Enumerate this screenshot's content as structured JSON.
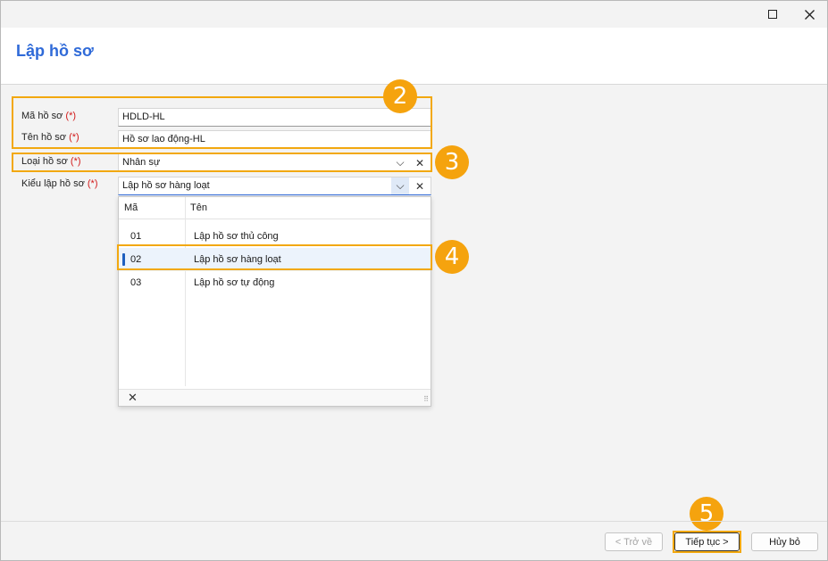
{
  "window": {
    "page_title": "Lập hồ sơ",
    "maximize_icon": "maximize-icon",
    "close_icon": "close-icon"
  },
  "form": {
    "fields": [
      {
        "label": "Mã hồ sơ",
        "required_mark": "(*)",
        "value": "HDLD-HL"
      },
      {
        "label": "Tên hồ sơ",
        "required_mark": "(*)",
        "value": "Hồ sơ lao động-HL"
      },
      {
        "label": "Loại hồ sơ",
        "required_mark": "(*)",
        "value": "Nhân sự"
      },
      {
        "label": "Kiểu lập hồ sơ",
        "required_mark": "(*)",
        "value": "Lập hồ sơ hàng loạt"
      }
    ],
    "dropdown_glyph": "⌵",
    "clear_glyph": "✕"
  },
  "dropdown": {
    "columns": [
      "Mã",
      "Tên"
    ],
    "rows": [
      {
        "code": "01",
        "name": "Lập hồ sơ thủ công"
      },
      {
        "code": "02",
        "name": "Lập hồ sơ hàng loạt"
      },
      {
        "code": "03",
        "name": "Lập hồ sơ tự động"
      }
    ],
    "selected_code": "02",
    "clear_glyph": "✕",
    "grip_glyph": "⠿"
  },
  "annotations": {
    "badges": [
      "2",
      "3",
      "4",
      "5"
    ],
    "color": "#f5a30e"
  },
  "buttons": {
    "back": "< Trở về",
    "next": "Tiếp tục >",
    "cancel": "Hủy bỏ"
  },
  "colors": {
    "title": "#2f6ad8",
    "required": "#d21a1a",
    "highlight": "#f2a80f",
    "selection_bar": "#1f5fbf"
  }
}
